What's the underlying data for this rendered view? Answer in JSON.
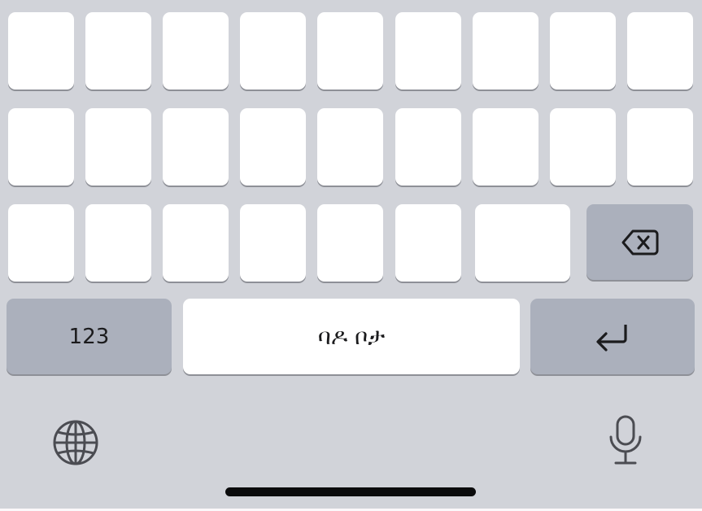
{
  "keyboard": {
    "numbers_key_label": "123",
    "space_key_label": "ባዶ ቦታ",
    "row1_key_count": 9,
    "row2_key_count": 9,
    "row3_key_count": 7,
    "icons": {
      "backspace": "backspace-icon",
      "return": "return-icon",
      "globe": "globe-icon",
      "microphone": "microphone-icon"
    },
    "colors": {
      "background": "#d1d3d9",
      "letter_key": "#ffffff",
      "function_key": "#abb0bc",
      "home_indicator": "#0b0b0c"
    }
  }
}
